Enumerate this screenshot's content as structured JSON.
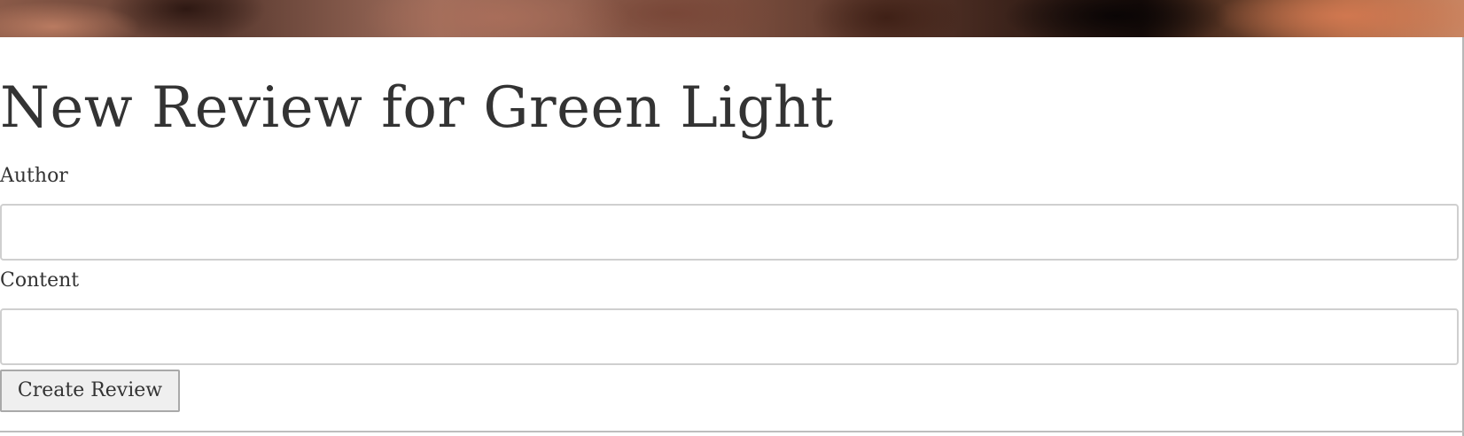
{
  "page": {
    "title": "New Review for Green Light"
  },
  "form": {
    "author": {
      "label": "Author",
      "value": "",
      "placeholder": ""
    },
    "content": {
      "label": "Content",
      "value": "",
      "placeholder": ""
    },
    "submit_label": "Create Review"
  },
  "hero": {
    "image_semantic": "chocolate-pieces-photo",
    "colors": [
      "#8a5a48",
      "#4a2c22",
      "#1a0e0a",
      "#c98562"
    ]
  }
}
